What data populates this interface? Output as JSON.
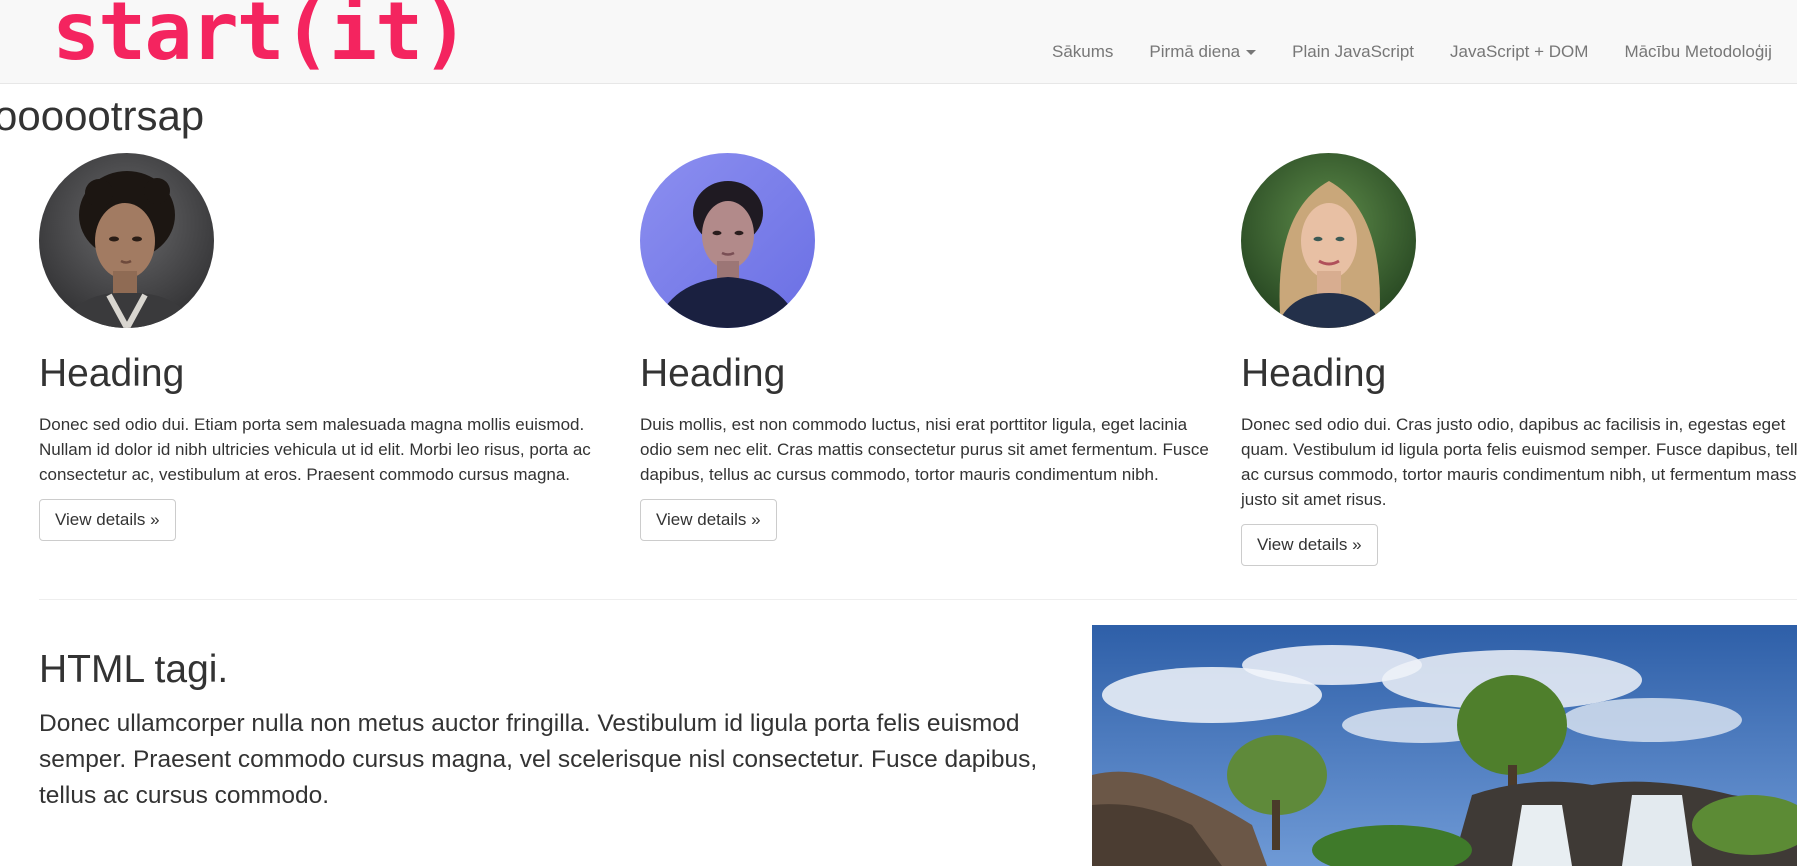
{
  "navbar": {
    "brand": "start(it)",
    "brand_color": "#f4245f",
    "links": [
      {
        "label": "Sākums"
      },
      {
        "label": "Pirmā diena"
      },
      {
        "label": "Plain JavaScript"
      },
      {
        "label": "JavaScript + DOM"
      },
      {
        "label": "Mācību Metodoloģij"
      }
    ]
  },
  "page": {
    "title": "oooootrsap"
  },
  "columns": [
    {
      "heading": "Heading",
      "text": "Donec sed odio dui. Etiam porta sem malesuada magna mollis euismod. Nullam id dolor id nibh ultricies vehicula ut id elit. Morbi leo risus, porta ac consectetur ac, vestibulum at eros. Praesent commodo cursus magna.",
      "button": "View details »",
      "avatar_icon": "portrait-woman-dark-background"
    },
    {
      "heading": "Heading",
      "text": "Duis mollis, est non commodo luctus, nisi erat porttitor ligula, eget lacinia odio sem nec elit. Cras mattis consectetur purus sit amet fermentum. Fusce dapibus, tellus ac cursus commodo, tortor mauris condimentum nibh.",
      "button": "View details »",
      "avatar_icon": "portrait-woman-blue-background"
    },
    {
      "heading": "Heading",
      "text": "Donec sed odio dui. Cras justo odio, dapibus ac facilisis in, egestas eget quam. Vestibulum id ligula porta felis euismod semper. Fusce dapibus, tellus ac cursus commodo, tortor mauris condimentum nibh, ut fermentum massa justo sit amet risus.",
      "button": "View details »",
      "avatar_icon": "portrait-woman-green-background"
    }
  ],
  "featurette": {
    "heading": "HTML tagi.",
    "lead": "Donec ullamcorper nulla non metus auctor fringilla. Vestibulum id ligula porta felis euismod semper. Praesent commodo cursus magna, vel scelerisque nisl consectetur. Fusce dapibus, tellus ac cursus commodo.",
    "image_icon": "waterfall-landscape-photo"
  }
}
